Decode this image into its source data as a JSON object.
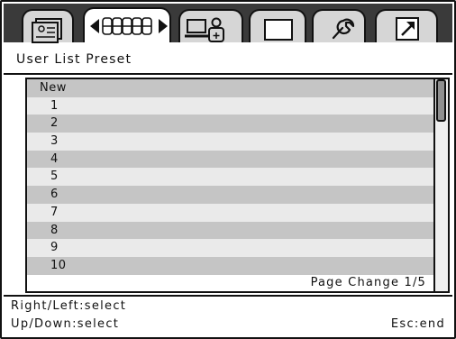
{
  "tabs": [
    {
      "icon": "user-list-icon",
      "active": false
    },
    {
      "icon": "key-presets-icon",
      "active": true
    },
    {
      "icon": "user-computer-icon",
      "active": false
    },
    {
      "icon": "blank-display-icon",
      "active": false
    },
    {
      "icon": "wrench-icon",
      "active": false
    },
    {
      "icon": "export-arrow-icon",
      "active": false
    }
  ],
  "title": "User List Preset",
  "list": {
    "items": [
      "New",
      "1",
      "2",
      "3",
      "4",
      "5",
      "6",
      "7",
      "8",
      "9",
      "10"
    ],
    "page_change": "Page Change 1/5",
    "scroll_position": 0.2
  },
  "footer": {
    "left_right": "Right/Left:select",
    "up_down": "Up/Down:select",
    "esc": "Esc:end"
  },
  "colors": {
    "odd_row": "#c5c5c5",
    "even_row": "#eaeaea",
    "tabbar": "#3a3a3a",
    "thumb": "#909090"
  }
}
